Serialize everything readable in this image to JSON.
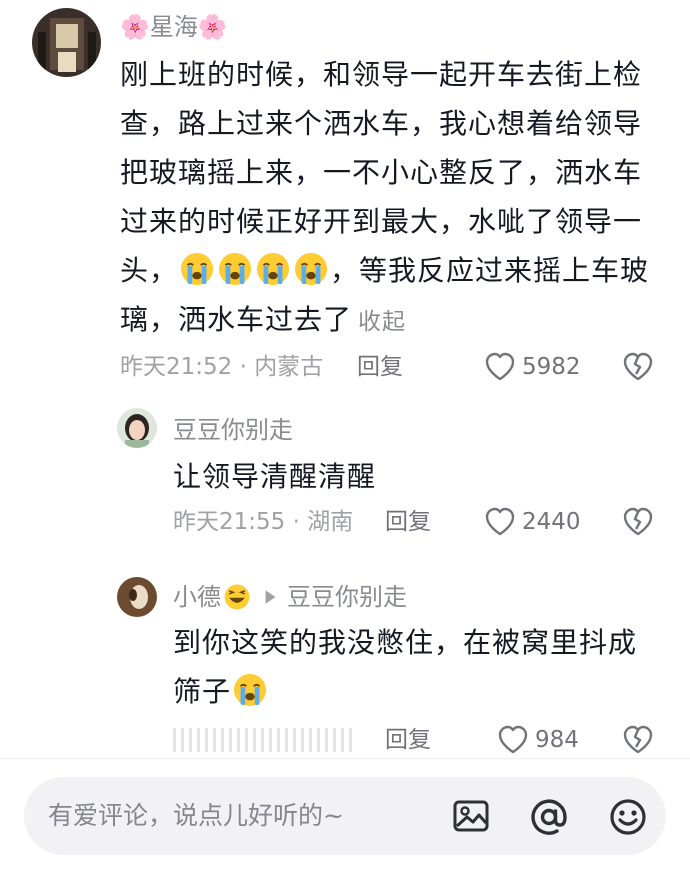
{
  "comments": [
    {
      "username": "🌸星海🌸",
      "text_lines": [
        "刚上班的时候，和领导一起开车去街上检",
        "查，路上过来个洒水车，我心想着给领导",
        "把玻璃摇上来，一不小心整反了，洒水车",
        "过来的时候正好开到最大，水呲了领导一",
        "头，",
        "，等我反应过来摇上车玻",
        "璃，洒水车过去了"
      ],
      "collapse_label": "收起",
      "meta": "昨天21:52 · 内蒙古",
      "reply_label": "回复",
      "likes": "5982"
    },
    {
      "username": "豆豆你别走",
      "text": "让领导清醒清醒",
      "meta": "昨天21:55 · 湖南",
      "reply_label": "回复",
      "likes": "2440"
    },
    {
      "username": "小德",
      "reply_to": "豆豆你别走",
      "text_lines": [
        "到你这笑的我没憋住，在被窝里抖成",
        "筛子"
      ],
      "reply_label": "回复",
      "likes": "984"
    }
  ],
  "input": {
    "placeholder": "有爱评论，说点儿好听的~"
  },
  "icons": [
    "cry-emoji-icon",
    "heart-icon",
    "broken-heart-icon",
    "image-icon",
    "at-icon",
    "smiley-icon",
    "play-arrow-icon",
    "laugh-emoji-icon"
  ]
}
